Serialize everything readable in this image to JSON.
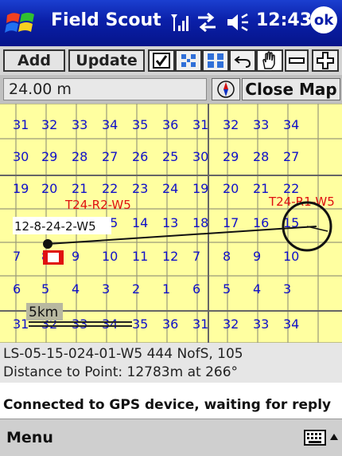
{
  "titlebar": {
    "app_title": "Field Scout",
    "clock": "12:43",
    "ok_label": "ok"
  },
  "toolbar": {
    "add_label": "Add",
    "update_label": "Update"
  },
  "distance": {
    "value": "24.00 m",
    "close_map_label": "Close Map"
  },
  "map": {
    "rows": [
      [
        "31",
        "32",
        "33",
        "34",
        "35",
        "36",
        "31",
        "32",
        "33",
        "34"
      ],
      [
        "30",
        "29",
        "28",
        "27",
        "26",
        "25",
        "30",
        "29",
        "28",
        "27"
      ],
      [
        "19",
        "20",
        "21",
        "22",
        "23",
        "24",
        "19",
        "20",
        "21",
        "22"
      ],
      [
        "",
        "",
        "",
        "15",
        "14",
        "13",
        "18",
        "17",
        "16",
        "15"
      ],
      [
        "7",
        "8",
        "9",
        "10",
        "11",
        "12",
        "7",
        "8",
        "9",
        "10"
      ],
      [
        "6",
        "5",
        "4",
        "3",
        "2",
        "1",
        "6",
        "5",
        "4",
        "3"
      ],
      [
        "31",
        "32",
        "33",
        "34",
        "35",
        "36",
        "31",
        "32",
        "33",
        "34"
      ]
    ],
    "township_left": "T24-R2-W5",
    "township_right": "T24-R1-W5",
    "point_label": "12-8-24-2-W5",
    "scale_label": "5km"
  },
  "info": {
    "location": "LS-05-15-024-01-W5 444 NofS, 105",
    "distance_to_point": "Distance to Point: 12783m at 266°"
  },
  "status": "Connected to GPS device, waiting for reply",
  "menubar": {
    "menu_label": "Menu"
  }
}
